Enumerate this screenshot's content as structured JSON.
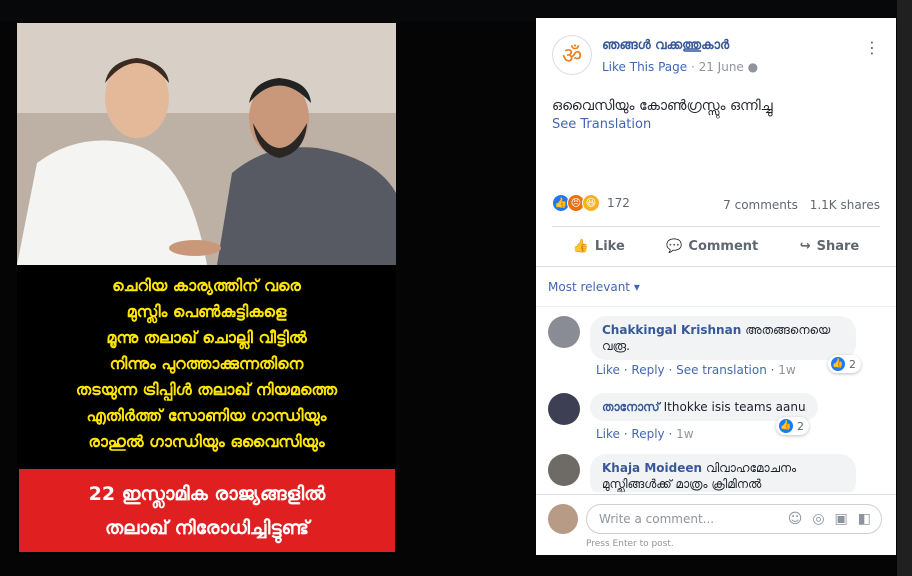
{
  "post": {
    "page_name": "ഞങ്ങൾ വക്കത്തുകാർ",
    "like_page": "Like This Page",
    "date": "21 June",
    "text": "ഒവൈസിയും കോൺഗ്രസ്സും ഒന്നിച്ചു",
    "see_translation": "See Translation",
    "reaction_count": "172",
    "comments": "7 comments",
    "shares": "1.1K shares"
  },
  "actions": {
    "like": "Like",
    "comment": "Comment",
    "share": "Share"
  },
  "filter": "Most relevant",
  "comments": [
    {
      "author": "Chakkingal Krishnan",
      "text": "അതങ്ങനെയെ വരൂ.",
      "like": "Like",
      "reply": "Reply",
      "see_translation": "See translation",
      "time": "1w",
      "reactions": "2"
    },
    {
      "author": "താനോസ്",
      "text": "Ithokke isis teams aanu",
      "like": "Like",
      "reply": "Reply",
      "time": "1w",
      "reactions": "2"
    },
    {
      "author": "Khaja Moideen",
      "text": "വിവാഹമോചനം മുസ്ലിങ്ങൾക്ക് മാത്രം ക്രിമിനൽ"
    }
  ],
  "composer": {
    "placeholder": "Write a comment...",
    "hint": "Press Enter to post."
  },
  "media": {
    "lines": [
      "ചെറിയ കാര്യത്തിന് വരെ",
      "മുസ്ലിം പെൺകുട്ടികളെ",
      "മൂന്നു തലാഖ് ചൊല്ലി വീട്ടിൽ",
      "നിന്നും പുറത്താക്കുന്നതിനെ",
      "തടയുന്ന ട്രിപ്പിൾ തലാഖ് നിയമത്തെ",
      "എതിർത്ത് സോണിയ ഗാന്ധിയും",
      "രാഹുൽ ഗാന്ധിയും ഒവൈസിയും"
    ],
    "red_lines": [
      "22 ഇസ്ലാമിക രാജ്യങ്ങളിൽ",
      "തലാഖ് നിരോധിച്ചിട്ടുണ്ട്"
    ]
  },
  "colors": {
    "link": "#4267b2",
    "text_yellow": "#ffe600",
    "red_box": "#e02020"
  }
}
